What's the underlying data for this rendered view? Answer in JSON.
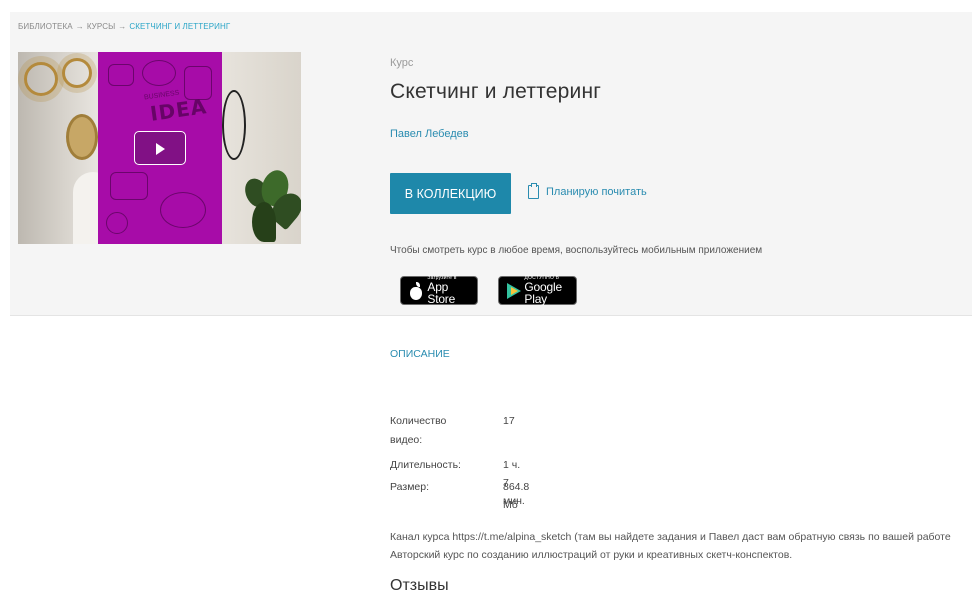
{
  "breadcrumb": {
    "items": [
      "БИБЛИОТЕКА",
      "КУРСЫ"
    ],
    "separator": "→",
    "current": "СКЕТЧИНГ И ЛЕТТЕРИНГ"
  },
  "video": {
    "thumbnail_texts": {
      "small": "BUSINESS",
      "big": "IDEA"
    },
    "play_icon": "play-icon"
  },
  "course": {
    "kicker": "Курс",
    "title": "Скетчинг и леттеринг",
    "author": "Павел Лебедев"
  },
  "actions": {
    "collection_button": "В КОЛЛЕКЦИЮ",
    "plan_label": "Планирую почитать",
    "plan_icon": "clipboard-icon"
  },
  "mobile": {
    "note": "Чтобы смотреть курс в любое время, воспользуйтесь мобильным приложением",
    "appstore": {
      "small": "Загрузите в",
      "big": "App Store"
    },
    "googleplay": {
      "small": "ДОСТУПНО В",
      "big": "Google Play"
    }
  },
  "tabs": {
    "description": "ОПИСАНИЕ"
  },
  "meta": {
    "videos_label_1": "Количество",
    "videos_label_2": "видео:",
    "videos_value": "17",
    "duration_label": "Длительность:",
    "duration_value": "1 ч. 7 мин.",
    "size_label": "Размер:",
    "size_value": "864.8 Мб"
  },
  "description": {
    "line1": "Канал курса https://t.me/alpina_sketch (там вы найдете задания и Павел даст вам обратную связь по вашей работе",
    "line2": "Авторский курс по созданию иллюстраций от руки и креативных скетч-конспектов."
  },
  "reviews": {
    "heading": "Отзывы"
  },
  "colors": {
    "accent": "#1e88aa",
    "link": "#2a8cb0",
    "hero_bg": "#f5f5f5",
    "thumbnail_purple": "#a70ca8"
  }
}
